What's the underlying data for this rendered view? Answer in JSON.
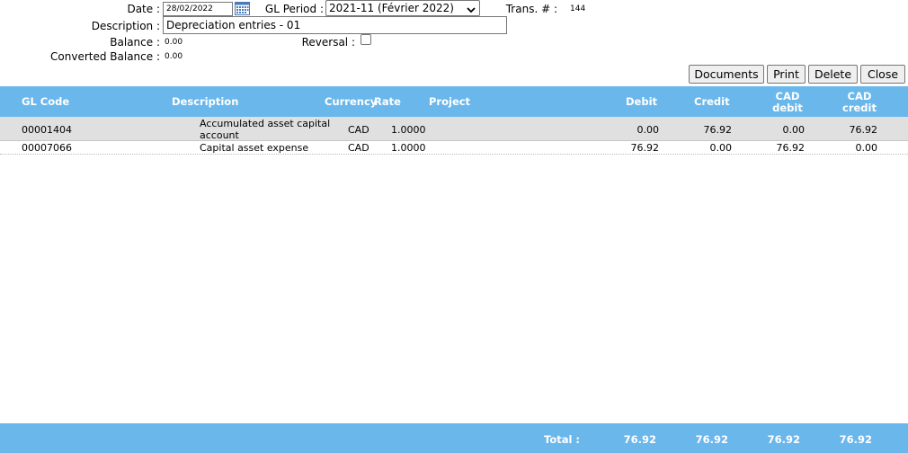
{
  "form": {
    "date_label": "Date :",
    "date_value": "28/02/2022",
    "gl_period_label": "GL Period :",
    "gl_period_value": "2021-11 (Février 2022)",
    "trans_label": "Trans. # :",
    "trans_value": "144",
    "description_label": "Description :",
    "description_value": "Depreciation entries - 01",
    "balance_label": "Balance :",
    "balance_value": "0.00",
    "reversal_label": "Reversal :",
    "reversal_checked": false,
    "converted_balance_label": "Converted Balance :",
    "converted_balance_value": "0.00"
  },
  "toolbar": {
    "documents_label": "Documents",
    "print_label": "Print",
    "delete_label": "Delete",
    "close_label": "Close"
  },
  "table": {
    "headers": {
      "gl_code": "GL Code",
      "description": "Description",
      "currency": "Currency",
      "rate": "Rate",
      "project": "Project",
      "debit": "Debit",
      "credit": "Credit",
      "cad_debit_1": "CAD",
      "cad_debit_2": "debit",
      "cad_credit_1": "CAD",
      "cad_credit_2": "credit"
    },
    "rows": [
      {
        "gl_code": "00001404",
        "description_1": "Accumulated asset capital",
        "description_2": "account",
        "currency": "CAD",
        "rate": "1.0000",
        "project": "",
        "debit": "0.00",
        "credit": "76.92",
        "cad_debit": "0.00",
        "cad_credit": "76.92"
      },
      {
        "gl_code": "00007066",
        "description_1": "Capital asset expense",
        "currency": "CAD",
        "rate": "1.0000",
        "project": "",
        "debit": "76.92",
        "credit": "0.00",
        "cad_debit": "76.92",
        "cad_credit": "0.00"
      }
    ]
  },
  "totals": {
    "label": "Total :",
    "debit": "76.92",
    "credit": "76.92",
    "cad_debit": "76.92",
    "cad_credit": "76.92"
  },
  "colors": {
    "header_bg": "#6ab7ec",
    "selected_row_bg": "#e0e0e0"
  }
}
